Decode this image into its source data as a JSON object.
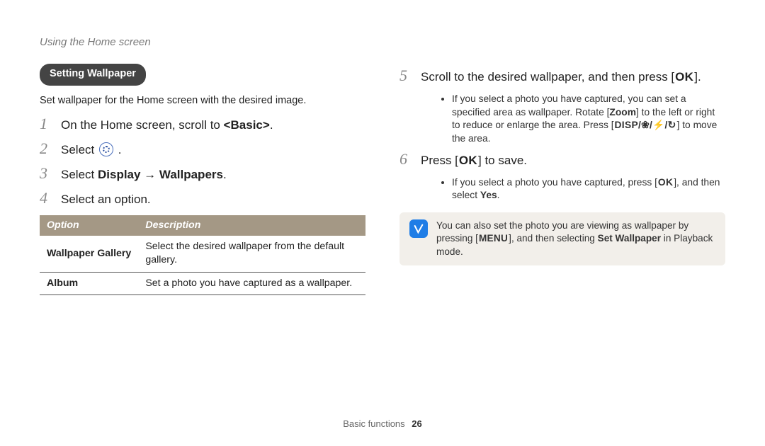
{
  "breadcrumb": "Using the Home screen",
  "section_pill": "Setting Wallpaper",
  "intro": "Set wallpaper for the Home screen with the desired image.",
  "steps_left": {
    "s1_num": "1",
    "s1_pre": "On the Home screen, scroll to ",
    "s1_bold": "<Basic>",
    "s1_post": ".",
    "s2_num": "2",
    "s2_pre": "Select ",
    "s2_post": ".",
    "s3_num": "3",
    "s3_pre": "Select ",
    "s3_bold": "Display → Wallpapers",
    "s3_post": ".",
    "s4_num": "4",
    "s4_text": "Select an option."
  },
  "option_table": {
    "head_option": "Option",
    "head_desc": "Description",
    "rows": [
      {
        "opt": "Wallpaper Gallery",
        "desc": "Select the desired wallpaper from the default gallery."
      },
      {
        "opt": "Album",
        "desc": "Set a photo you have captured as a wallpaper."
      }
    ]
  },
  "steps_right": {
    "s5_num": "5",
    "s5_pre": "Scroll to the desired wallpaper, and then press [",
    "s5_key": "OK",
    "s5_post": "].",
    "s5_b1_pre": "If you select a photo you have captured, you can set a specified area as wallpaper. Rotate [",
    "s5_b1_zoom": "Zoom",
    "s5_b1_mid": "] to the left or right to reduce or enlarge the area. Press [",
    "s5_b1_keys": "DISP/❀/⚡/↻",
    "s5_b1_post": "] to move the area.",
    "s6_num": "6",
    "s6_pre": "Press [",
    "s6_key": "OK",
    "s6_post": "] to save.",
    "s6_b1_pre": "If you select a photo you have captured, press [",
    "s6_b1_key": "OK",
    "s6_b1_mid": "], and then select ",
    "s6_b1_yes": "Yes",
    "s6_b1_post": "."
  },
  "note": {
    "pre": "You can also set the photo you are viewing as wallpaper by pressing [",
    "menu": "MENU",
    "mid": "], and then selecting ",
    "set": "Set Wallpaper",
    "post": " in Playback mode."
  },
  "footer_section": "Basic functions",
  "footer_page": "26"
}
